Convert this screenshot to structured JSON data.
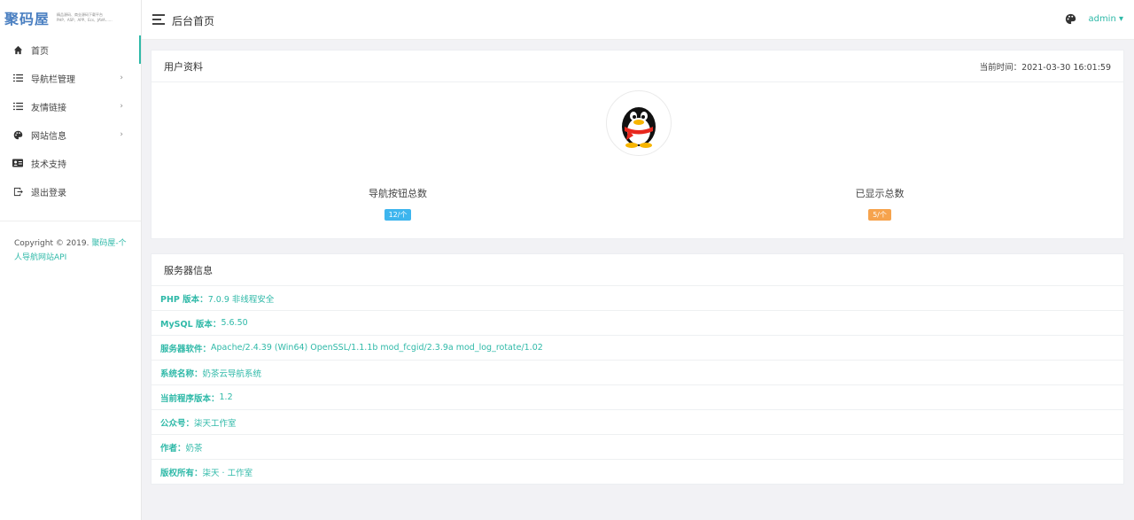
{
  "logo": {
    "text": "聚码屋",
    "tagline_1": "精品源码、商业源码下载平台",
    "tagline_2": "PHP、ASP、APP、Ecs、JAVA……"
  },
  "sidebar": {
    "items": [
      {
        "label": "首页",
        "icon": "home-icon",
        "has_arrow": false
      },
      {
        "label": "导航栏管理",
        "icon": "list-icon",
        "has_arrow": true
      },
      {
        "label": "友情链接",
        "icon": "list-icon",
        "has_arrow": true
      },
      {
        "label": "网站信息",
        "icon": "palette-icon",
        "has_arrow": true
      },
      {
        "label": "技术支持",
        "icon": "id-card-icon",
        "has_arrow": false
      },
      {
        "label": "退出登录",
        "icon": "logout-icon",
        "has_arrow": false
      }
    ],
    "arrow": "›",
    "copyright_prefix": "Copyright © 2019.",
    "copyright_link": "聚码屋-个人导航网站API"
  },
  "header": {
    "title": "后台首页",
    "user": "admin ▾"
  },
  "profile_panel": {
    "title": "用户资料",
    "time_label": "当前时间：",
    "time_value": "2021-03-30 16:01:59",
    "stat_1_label": "导航按钮总数",
    "stat_1_value": "12/个",
    "stat_2_label": "已显示总数",
    "stat_2_value": "5/个"
  },
  "server_panel": {
    "title": "服务器信息",
    "rows": [
      {
        "key": "PHP 版本：",
        "value": "7.0.9 非线程安全"
      },
      {
        "key": "MySQL 版本：",
        "value": "5.6.50"
      },
      {
        "key": "服务器软件：",
        "value": "Apache/2.4.39 (Win64) OpenSSL/1.1.1b mod_fcgid/2.3.9a mod_log_rotate/1.02"
      },
      {
        "key": "系统名称：",
        "value": "奶茶云导航系统"
      },
      {
        "key": "当前程序版本：",
        "value": "1.2"
      },
      {
        "key": "公众号：",
        "value": "柒天工作室"
      },
      {
        "key": "作者：",
        "value": "奶茶"
      },
      {
        "key": "版权所有：",
        "value": "柒天 · 工作室"
      }
    ]
  },
  "colors": {
    "accent": "#2fb9a8",
    "badge_blue": "#3db5ee",
    "badge_orange": "#f6a34d",
    "logo_blue": "#4a7fc1"
  }
}
